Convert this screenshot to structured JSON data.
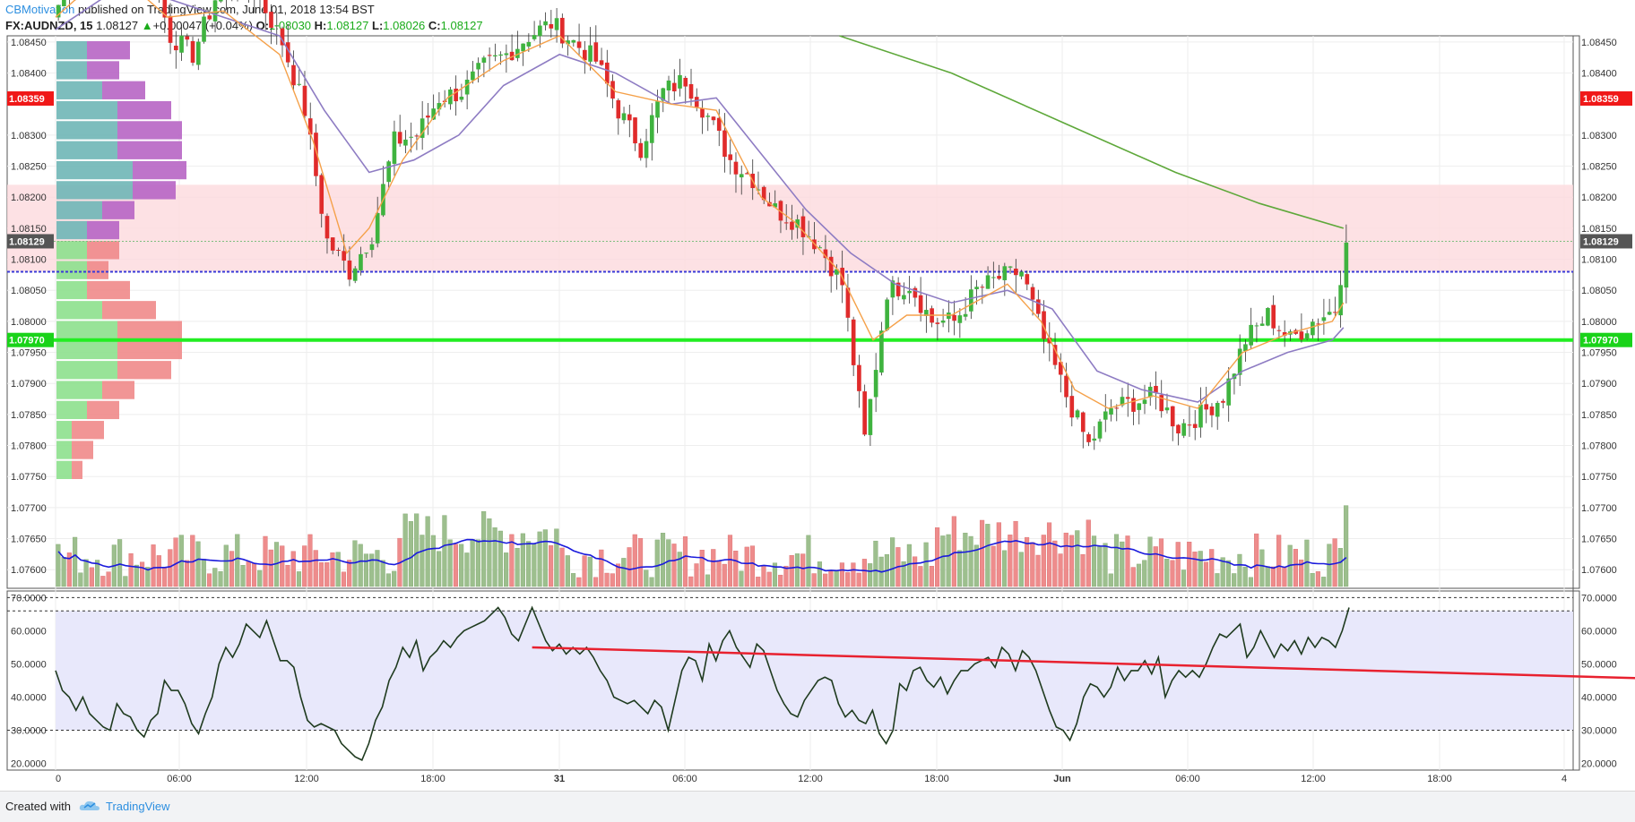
{
  "header": {
    "author": "CBMotivation",
    "published_text": "published on TradingView.com, June 01, 2018 13:54 BST",
    "symbol": "FX:AUDNZD, 15",
    "last": "1.08127",
    "change_arrow": "▲",
    "change": "+0.00047 (+0.04%)",
    "o_label": "O:",
    "o": "1.08030",
    "h_label": "H:",
    "h": "1.08127",
    "l_label": "L:",
    "l": "1.08026",
    "c_label": "C:",
    "c": "1.08127"
  },
  "footer": {
    "created_with": "Created with",
    "brand": "TradingView"
  },
  "colors": {
    "up": "#3fb33f",
    "down": "#e02b2b",
    "vol_up": "#9dbf8e",
    "vol_down": "#ee8c8c",
    "ema_fast": "#f5a14a",
    "sma_slow": "#8e7cc3",
    "ma_long": "#5ea83a",
    "zone": "#fcd9dd",
    "support": "#22ee22",
    "rsi": "#1f3b1f",
    "rsi_band": "#e6e6fb",
    "trendline": "#e8212f",
    "vol_ma": "#1a1adc"
  },
  "chart_data": [
    {
      "type": "candlestick",
      "symbol": "FX:AUDNZD",
      "interval": "15",
      "ylim": [
        1.0757,
        1.0846
      ],
      "y_ticks": [
        "1.08450",
        "1.08400",
        "1.08300",
        "1.08250",
        "1.08200",
        "1.08150",
        "1.08100",
        "1.08050",
        "1.08000",
        "1.07950",
        "1.07900",
        "1.07850",
        "1.07800",
        "1.07750",
        "1.07700",
        "1.07650",
        "1.07600"
      ],
      "x_ticks": [
        "0",
        "06:00",
        "12:00",
        "18:00",
        "31",
        "06:00",
        "12:00",
        "18:00",
        "Jun",
        "06:00",
        "12:00",
        "18:00",
        "4"
      ],
      "price_labels": {
        "upper_red": "1.08359",
        "current": "1.08129",
        "support": "1.07970"
      },
      "levels": {
        "upper_red": 1.08359,
        "current": 1.08129,
        "support": 1.0797,
        "dotted_blue": 1.0808,
        "zone_top": 1.0822,
        "zone_bottom": 1.0808
      },
      "close_points": [
        [
          0,
          1.0851
        ],
        [
          6,
          1.0859
        ],
        [
          12,
          1.0862
        ],
        [
          16,
          1.0858
        ],
        [
          20,
          1.0846
        ],
        [
          24,
          1.0843
        ],
        [
          28,
          1.0852
        ],
        [
          32,
          1.0855
        ],
        [
          36,
          1.0852
        ],
        [
          40,
          1.0845
        ],
        [
          44,
          1.0834
        ],
        [
          48,
          1.0813
        ],
        [
          52,
          1.0808
        ],
        [
          56,
          1.0814
        ],
        [
          60,
          1.0829
        ],
        [
          64,
          1.083
        ],
        [
          68,
          1.0836
        ],
        [
          72,
          1.0837
        ],
        [
          76,
          1.0841
        ],
        [
          80,
          1.0843
        ],
        [
          84,
          1.0846
        ],
        [
          88,
          1.0848
        ],
        [
          92,
          1.0845
        ],
        [
          96,
          1.0842
        ],
        [
          100,
          1.0834
        ],
        [
          104,
          1.0828
        ],
        [
          108,
          1.0837
        ],
        [
          112,
          1.0839
        ],
        [
          116,
          1.0833
        ],
        [
          120,
          1.0826
        ],
        [
          124,
          1.0823
        ],
        [
          128,
          1.0818
        ],
        [
          132,
          1.0816
        ],
        [
          136,
          1.0812
        ],
        [
          140,
          1.0806
        ],
        [
          144,
          1.0781
        ],
        [
          148,
          1.0805
        ],
        [
          152,
          1.0806
        ],
        [
          156,
          1.08
        ],
        [
          160,
          1.08
        ],
        [
          164,
          1.0805
        ],
        [
          168,
          1.0807
        ],
        [
          172,
          1.0808
        ],
        [
          176,
          1.0797
        ],
        [
          180,
          1.0788
        ],
        [
          184,
          1.078
        ],
        [
          188,
          1.0786
        ],
        [
          192,
          1.0787
        ],
        [
          196,
          1.0788
        ],
        [
          200,
          1.0783
        ],
        [
          204,
          1.0785
        ],
        [
          208,
          1.0788
        ],
        [
          212,
          1.0797
        ],
        [
          216,
          1.0801
        ],
        [
          220,
          1.0797
        ],
        [
          224,
          1.08
        ],
        [
          228,
          1.0802
        ],
        [
          230,
          1.0813
        ]
      ],
      "ema_fast_points": [
        [
          0,
          1.0849
        ],
        [
          10,
          1.0857
        ],
        [
          20,
          1.0849
        ],
        [
          30,
          1.085
        ],
        [
          40,
          1.0843
        ],
        [
          46,
          1.0829
        ],
        [
          52,
          1.0811
        ],
        [
          56,
          1.0815
        ],
        [
          62,
          1.0826
        ],
        [
          70,
          1.0836
        ],
        [
          80,
          1.0842
        ],
        [
          90,
          1.0846
        ],
        [
          100,
          1.0837
        ],
        [
          110,
          1.0835
        ],
        [
          118,
          1.0834
        ],
        [
          126,
          1.082
        ],
        [
          132,
          1.0816
        ],
        [
          140,
          1.0808
        ],
        [
          146,
          1.0797
        ],
        [
          152,
          1.0801
        ],
        [
          160,
          1.0801
        ],
        [
          170,
          1.0806
        ],
        [
          176,
          1.08
        ],
        [
          182,
          1.0789
        ],
        [
          188,
          1.0786
        ],
        [
          196,
          1.0788
        ],
        [
          204,
          1.0786
        ],
        [
          212,
          1.0795
        ],
        [
          220,
          1.0798
        ],
        [
          228,
          1.08
        ],
        [
          230,
          1.0803
        ]
      ],
      "sma_slow_points": [
        [
          0,
          1.0847
        ],
        [
          10,
          1.0853
        ],
        [
          20,
          1.0852
        ],
        [
          30,
          1.0849
        ],
        [
          40,
          1.0846
        ],
        [
          48,
          1.0834
        ],
        [
          56,
          1.0824
        ],
        [
          64,
          1.0826
        ],
        [
          72,
          1.083
        ],
        [
          80,
          1.0838
        ],
        [
          90,
          1.0843
        ],
        [
          100,
          1.084
        ],
        [
          110,
          1.0835
        ],
        [
          118,
          1.0836
        ],
        [
          126,
          1.0827
        ],
        [
          134,
          1.0818
        ],
        [
          142,
          1.0811
        ],
        [
          150,
          1.0806
        ],
        [
          160,
          1.0803
        ],
        [
          170,
          1.0805
        ],
        [
          178,
          1.0802
        ],
        [
          186,
          1.0792
        ],
        [
          194,
          1.0789
        ],
        [
          204,
          1.0787
        ],
        [
          212,
          1.0792
        ],
        [
          220,
          1.0795
        ],
        [
          228,
          1.0797
        ],
        [
          230,
          1.0799
        ]
      ],
      "ma_long_points": [
        [
          140,
          1.0846
        ],
        [
          160,
          1.084
        ],
        [
          180,
          1.0832
        ],
        [
          200,
          1.0824
        ],
        [
          215,
          1.0819
        ],
        [
          230,
          1.0815
        ]
      ],
      "volume_profile_up": [
        2,
        2,
        3,
        4,
        4,
        4,
        5,
        5,
        3,
        2,
        2,
        2,
        2,
        3,
        4,
        4,
        4,
        3,
        2,
        1,
        1,
        1
      ],
      "volume_profile_down": [
        4,
        3,
        4,
        5,
        6,
        6,
        5,
        4,
        3,
        3,
        3,
        2,
        4,
        5,
        6,
        6,
        5,
        3,
        3,
        3,
        2,
        1
      ]
    },
    {
      "type": "bar",
      "series_name": "Volume",
      "note_ma": "volume moving average",
      "values_pattern": "high near sessions, quiet between"
    },
    {
      "type": "line",
      "series_name": "RSI",
      "ylim": [
        18,
        72
      ],
      "y_ticks": [
        "70.0000",
        "60.0000",
        "50.0000",
        "40.0000",
        "30.0000",
        "20.0000"
      ],
      "levels": [
        70,
        66,
        30
      ],
      "values": [
        48,
        42,
        40,
        36,
        40,
        35,
        33,
        31,
        30,
        38,
        35,
        34,
        30,
        28,
        33,
        35,
        45,
        42,
        42,
        38,
        32,
        29,
        35,
        40,
        50,
        55,
        52,
        56,
        62,
        60,
        58,
        63,
        57,
        51,
        51,
        49,
        40,
        33,
        31,
        32,
        31,
        30,
        26,
        24,
        22,
        21,
        26,
        33,
        37,
        45,
        49,
        55,
        52,
        57,
        48,
        52,
        54,
        57,
        55,
        58,
        60,
        61,
        62,
        63,
        65,
        67,
        64,
        59,
        57,
        62,
        67,
        62,
        57,
        54,
        56,
        53,
        55,
        53,
        55,
        52,
        48,
        45,
        40,
        39,
        38,
        39,
        37,
        35,
        39,
        37,
        30,
        39,
        48,
        52,
        51,
        45,
        56,
        51,
        57,
        60,
        55,
        52,
        49,
        56,
        54,
        48,
        42,
        38,
        35,
        34,
        39,
        42,
        45,
        46,
        45,
        38,
        34,
        36,
        33,
        32,
        36,
        29,
        26,
        30,
        44,
        42,
        48,
        49,
        45,
        43,
        46,
        41,
        45,
        48,
        48,
        50,
        51,
        52,
        49,
        55,
        53,
        48,
        54,
        52,
        48,
        42,
        36,
        31,
        30,
        27,
        32,
        40,
        44,
        43,
        40,
        43,
        49,
        45,
        48,
        48,
        51,
        47,
        52,
        40,
        45,
        48,
        46,
        48,
        46,
        50,
        55,
        59,
        58,
        60,
        62,
        52,
        55,
        60,
        56,
        52,
        56,
        54,
        57,
        53,
        58,
        55,
        58,
        57,
        55,
        60,
        67
      ],
      "trendline_start": [
        70,
        55
      ],
      "trendline_end": [
        245,
        45
      ]
    }
  ]
}
